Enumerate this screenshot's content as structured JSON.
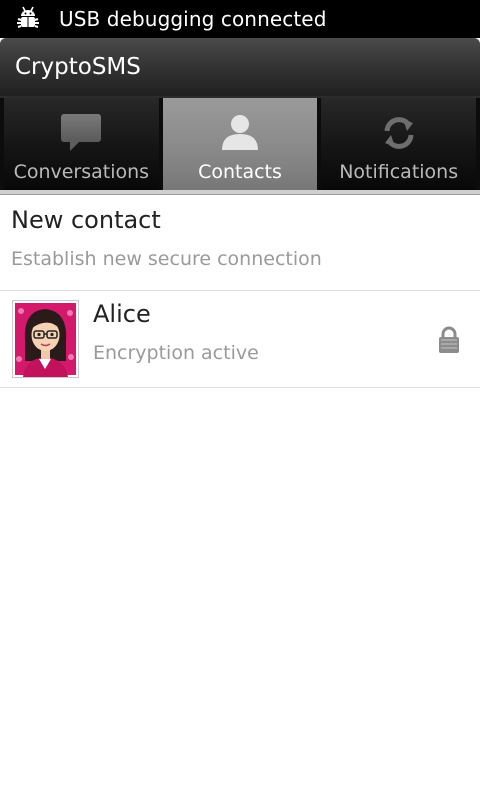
{
  "status_bar": {
    "icon": "android-debug-icon",
    "text": "USB debugging connected"
  },
  "title_bar": {
    "title": "CryptoSMS"
  },
  "tabs": [
    {
      "label": "Conversations",
      "icon": "speech-bubble-icon",
      "active": false
    },
    {
      "label": "Contacts",
      "icon": "person-icon",
      "active": true
    },
    {
      "label": "Notifications",
      "icon": "sync-icon",
      "active": false
    }
  ],
  "list": {
    "new_contact": {
      "title": "New contact",
      "subtitle": "Establish new secure connection"
    },
    "contacts": [
      {
        "name": "Alice",
        "status": "Encryption active",
        "avatar": "avatar-alice",
        "status_icon": "lock-icon"
      }
    ]
  },
  "colors": {
    "status_bar_bg": "#000000",
    "title_bar_bg": "#353535",
    "tab_active_bg": "#8a8a8a",
    "tab_inactive_bg": "#161616",
    "secondary_text": "#9a9a9a",
    "avatar_accent": "#d4186c"
  }
}
